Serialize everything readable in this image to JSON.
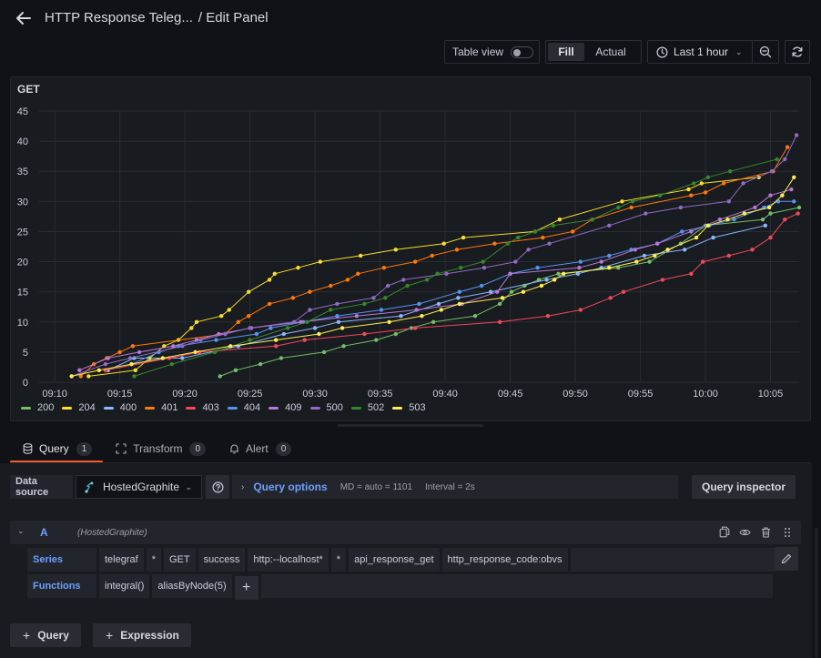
{
  "header": {
    "dashboard_title": "HTTP Response Teleg...",
    "separator_title": "/ Edit Panel"
  },
  "toolbar": {
    "table_view_label": "Table view",
    "table_view_on": false,
    "fill_label": "Fill",
    "actual_label": "Actual",
    "time_range_label": "Last 1 hour"
  },
  "panel": {
    "title": "GET"
  },
  "chart_data": {
    "type": "line",
    "title": "GET",
    "xlabel": "",
    "ylabel": "",
    "ylim": [
      0,
      45
    ],
    "y_ticks": [
      "0",
      "5",
      "10",
      "15",
      "20",
      "25",
      "30",
      "35",
      "40",
      "45"
    ],
    "x_ticks": [
      "09:10",
      "09:15",
      "09:20",
      "09:25",
      "09:30",
      "09:35",
      "09:40",
      "09:45",
      "09:50",
      "09:55",
      "10:00",
      "10:05"
    ],
    "x_range_minutes": [
      -1.2,
      57.2
    ],
    "x_unit": "minutes after 09:10",
    "grid": true,
    "legend_position": "bottom-left",
    "series": [
      {
        "name": "200",
        "color": "#73bf69",
        "points": [
          [
            12.7,
            1
          ],
          [
            13.9,
            2
          ],
          [
            15.8,
            3
          ],
          [
            17.4,
            4
          ],
          [
            20.7,
            5
          ],
          [
            22.2,
            6
          ],
          [
            24.7,
            7
          ],
          [
            26.2,
            8
          ],
          [
            27.4,
            9
          ],
          [
            29.1,
            10
          ],
          [
            32.3,
            11
          ],
          [
            34.2,
            13
          ],
          [
            35.1,
            15
          ],
          [
            36.1,
            16
          ],
          [
            37.2,
            17
          ],
          [
            38.7,
            18
          ],
          [
            43.3,
            19
          ],
          [
            45.7,
            20
          ],
          [
            48.1,
            23
          ],
          [
            50.0,
            26
          ],
          [
            54.4,
            27
          ],
          [
            55.0,
            28
          ],
          [
            57.2,
            29
          ]
        ]
      },
      {
        "name": "204",
        "color": "#fade2a",
        "points": [
          [
            2.6,
            1
          ],
          [
            6.2,
            2
          ],
          [
            7.3,
            4
          ],
          [
            8.4,
            6
          ],
          [
            9.5,
            7
          ],
          [
            10.5,
            9
          ],
          [
            10.9,
            10
          ],
          [
            12.8,
            11
          ],
          [
            13.4,
            12
          ],
          [
            14.9,
            15
          ],
          [
            16.5,
            17
          ],
          [
            16.9,
            18
          ],
          [
            18.7,
            19
          ],
          [
            20.4,
            20
          ],
          [
            23.5,
            21
          ],
          [
            26.2,
            22
          ],
          [
            29.9,
            23
          ],
          [
            31.4,
            24
          ],
          [
            36.9,
            25
          ],
          [
            38.8,
            27
          ],
          [
            43.6,
            30
          ],
          [
            48.7,
            32
          ],
          [
            49.7,
            33
          ],
          [
            54.1,
            34
          ]
        ]
      },
      {
        "name": "400",
        "color": "#8ab8ff",
        "points": [
          [
            4.1,
            2
          ],
          [
            6.1,
            4
          ],
          [
            9.8,
            4
          ],
          [
            14.1,
            6
          ],
          [
            17.6,
            8
          ],
          [
            20.0,
            9
          ],
          [
            21.8,
            10
          ],
          [
            26.6,
            11
          ],
          [
            29.5,
            13
          ],
          [
            31.0,
            14
          ],
          [
            33.5,
            15
          ],
          [
            37.8,
            17
          ],
          [
            40.2,
            18
          ],
          [
            42.0,
            19
          ],
          [
            45.3,
            21
          ],
          [
            48.4,
            22
          ],
          [
            50.6,
            24
          ],
          [
            54.6,
            26
          ]
        ]
      },
      {
        "name": "401",
        "color": "#ff780a",
        "points": [
          [
            2.0,
            1
          ],
          [
            3.0,
            3
          ],
          [
            4.0,
            4
          ],
          [
            5.0,
            5
          ],
          [
            6.0,
            6
          ],
          [
            13.1,
            8
          ],
          [
            14.1,
            10
          ],
          [
            14.9,
            11
          ],
          [
            16.5,
            13
          ],
          [
            18.3,
            14
          ],
          [
            19.6,
            15
          ],
          [
            21.2,
            16
          ],
          [
            22.5,
            17
          ],
          [
            23.3,
            18
          ],
          [
            25.3,
            19
          ],
          [
            27.7,
            20
          ],
          [
            29.0,
            21
          ],
          [
            30.9,
            22
          ],
          [
            33.8,
            23
          ],
          [
            37.5,
            24
          ],
          [
            39.8,
            25
          ],
          [
            41.3,
            27
          ],
          [
            44.3,
            29
          ],
          [
            48.9,
            31
          ],
          [
            50.0,
            31.5
          ],
          [
            51.4,
            33
          ],
          [
            55.2,
            35
          ],
          [
            56.3,
            39
          ]
        ]
      },
      {
        "name": "403",
        "color": "#f2495c",
        "points": [
          [
            3.9,
            2
          ],
          [
            8.8,
            4
          ],
          [
            11.1,
            5
          ],
          [
            17.0,
            6
          ],
          [
            19.2,
            7
          ],
          [
            23.8,
            8
          ],
          [
            27.7,
            9
          ],
          [
            34.2,
            10
          ],
          [
            37.9,
            11
          ],
          [
            40.4,
            12
          ],
          [
            42.7,
            14
          ],
          [
            43.7,
            15
          ],
          [
            46.7,
            17
          ],
          [
            48.9,
            18
          ],
          [
            49.8,
            20
          ],
          [
            51.8,
            21
          ],
          [
            53.6,
            22
          ],
          [
            55.0,
            24
          ],
          [
            56.1,
            27
          ],
          [
            57.1,
            28
          ]
        ]
      },
      {
        "name": "404",
        "color": "#5794f2",
        "points": [
          [
            5.9,
            3
          ],
          [
            8.0,
            5
          ],
          [
            9.5,
            6
          ],
          [
            12.4,
            7
          ],
          [
            15.5,
            8
          ],
          [
            16.6,
            9
          ],
          [
            19.1,
            10
          ],
          [
            21.7,
            11
          ],
          [
            25.1,
            12
          ],
          [
            28.0,
            13
          ],
          [
            31.1,
            15
          ],
          [
            32.8,
            16
          ],
          [
            35.0,
            18
          ],
          [
            37.1,
            19
          ],
          [
            40.4,
            20
          ],
          [
            42.6,
            21
          ],
          [
            44.3,
            22
          ],
          [
            46.3,
            23
          ],
          [
            48.2,
            25
          ],
          [
            50.3,
            26
          ],
          [
            52.2,
            27
          ],
          [
            54.5,
            29
          ],
          [
            55.6,
            30
          ],
          [
            56.8,
            30
          ]
        ]
      },
      {
        "name": "409",
        "color": "#b877d9",
        "points": [
          [
            1.9,
            2
          ],
          [
            4.1,
            4
          ],
          [
            6.5,
            5
          ],
          [
            9.1,
            6
          ],
          [
            10.9,
            7
          ],
          [
            12.6,
            8
          ],
          [
            15.1,
            9
          ],
          [
            18.9,
            10
          ],
          [
            23.2,
            11
          ],
          [
            27.8,
            12
          ],
          [
            31.3,
            13
          ],
          [
            34.0,
            15
          ],
          [
            35.0,
            18
          ],
          [
            40.3,
            19
          ],
          [
            42.0,
            20
          ],
          [
            44.6,
            22
          ],
          [
            46.3,
            23
          ],
          [
            48.9,
            25
          ],
          [
            51.1,
            27
          ],
          [
            53.8,
            29
          ],
          [
            55.0,
            31
          ],
          [
            56.6,
            32
          ]
        ]
      },
      {
        "name": "500",
        "color": "#8f6cc4",
        "points": [
          [
            1.3,
            1
          ],
          [
            3.9,
            3
          ],
          [
            5.8,
            4
          ],
          [
            9.8,
            6
          ],
          [
            11.2,
            7
          ],
          [
            13.1,
            8
          ],
          [
            15.0,
            9
          ],
          [
            18.4,
            10
          ],
          [
            19.6,
            12
          ],
          [
            21.7,
            13
          ],
          [
            24.5,
            14
          ],
          [
            25.6,
            16
          ],
          [
            26.8,
            17
          ],
          [
            30.1,
            18
          ],
          [
            33.0,
            19
          ],
          [
            35.4,
            20
          ],
          [
            36.4,
            22
          ],
          [
            38.0,
            23
          ],
          [
            42.6,
            26
          ],
          [
            45.4,
            28
          ],
          [
            48.1,
            29
          ],
          [
            51.8,
            30
          ],
          [
            52.9,
            33
          ],
          [
            55.1,
            35
          ],
          [
            56.1,
            37
          ],
          [
            57.0,
            41
          ]
        ]
      },
      {
        "name": "502",
        "color": "#37872d",
        "points": [
          [
            6.1,
            1
          ],
          [
            9.0,
            3
          ],
          [
            12.3,
            5
          ],
          [
            15.0,
            7
          ],
          [
            17.9,
            9
          ],
          [
            19.4,
            10
          ],
          [
            21.2,
            12
          ],
          [
            23.8,
            13
          ],
          [
            25.4,
            14
          ],
          [
            27.1,
            16
          ],
          [
            28.6,
            17
          ],
          [
            29.4,
            18
          ],
          [
            31.2,
            19
          ],
          [
            32.9,
            20
          ],
          [
            34.8,
            23
          ],
          [
            35.6,
            24
          ],
          [
            36.9,
            25
          ],
          [
            38.3,
            26
          ],
          [
            41.3,
            27
          ],
          [
            43.3,
            29
          ],
          [
            44.4,
            30
          ],
          [
            46.5,
            31
          ],
          [
            49.1,
            33
          ],
          [
            50.2,
            34
          ],
          [
            51.9,
            35
          ],
          [
            55.5,
            37
          ]
        ]
      },
      {
        "name": "503",
        "color": "#ffee52",
        "points": [
          [
            1.3,
            1
          ],
          [
            3.4,
            2
          ],
          [
            5.9,
            3
          ],
          [
            8.3,
            4
          ],
          [
            10.8,
            5
          ],
          [
            13.5,
            6
          ],
          [
            17.0,
            7
          ],
          [
            20.3,
            8
          ],
          [
            22.1,
            9
          ],
          [
            25.7,
            10
          ],
          [
            28.2,
            11
          ],
          [
            29.7,
            12
          ],
          [
            31.1,
            13
          ],
          [
            34.4,
            14
          ],
          [
            36.0,
            15
          ],
          [
            37.4,
            16
          ],
          [
            38.4,
            17
          ],
          [
            39.1,
            18
          ],
          [
            42.6,
            19
          ],
          [
            44.7,
            20
          ],
          [
            46.1,
            21
          ],
          [
            47.1,
            22
          ],
          [
            49.3,
            24
          ],
          [
            50.2,
            26
          ],
          [
            51.7,
            27
          ],
          [
            53.0,
            28
          ],
          [
            54.9,
            29
          ],
          [
            55.9,
            31
          ],
          [
            56.8,
            34
          ]
        ]
      }
    ]
  },
  "tabs": [
    {
      "label": "Query",
      "count": "1",
      "active": true
    },
    {
      "label": "Transform",
      "count": "0",
      "active": false
    },
    {
      "label": "Alert",
      "count": "0",
      "active": false
    }
  ],
  "query_editor": {
    "data_source_label": "Data source",
    "data_source_value": "HostedGraphite",
    "query_options_label": "Query options",
    "md_text": "MD = auto = 1101",
    "interval_text": "Interval = 2s",
    "query_inspector_label": "Query inspector",
    "query": {
      "ref_id": "A",
      "ds_name": "(HostedGraphite)",
      "series_label": "Series",
      "series_segments": [
        "telegraf",
        "*",
        "GET",
        "success",
        "http:--localhost*",
        "*",
        "api_response_get",
        "http_response_code:obvs"
      ],
      "functions_label": "Functions",
      "functions": [
        "integral()",
        "aliasByNode(5)"
      ],
      "add_function_label": "+"
    },
    "add_query_label": "Query",
    "add_expression_label": "Expression"
  }
}
